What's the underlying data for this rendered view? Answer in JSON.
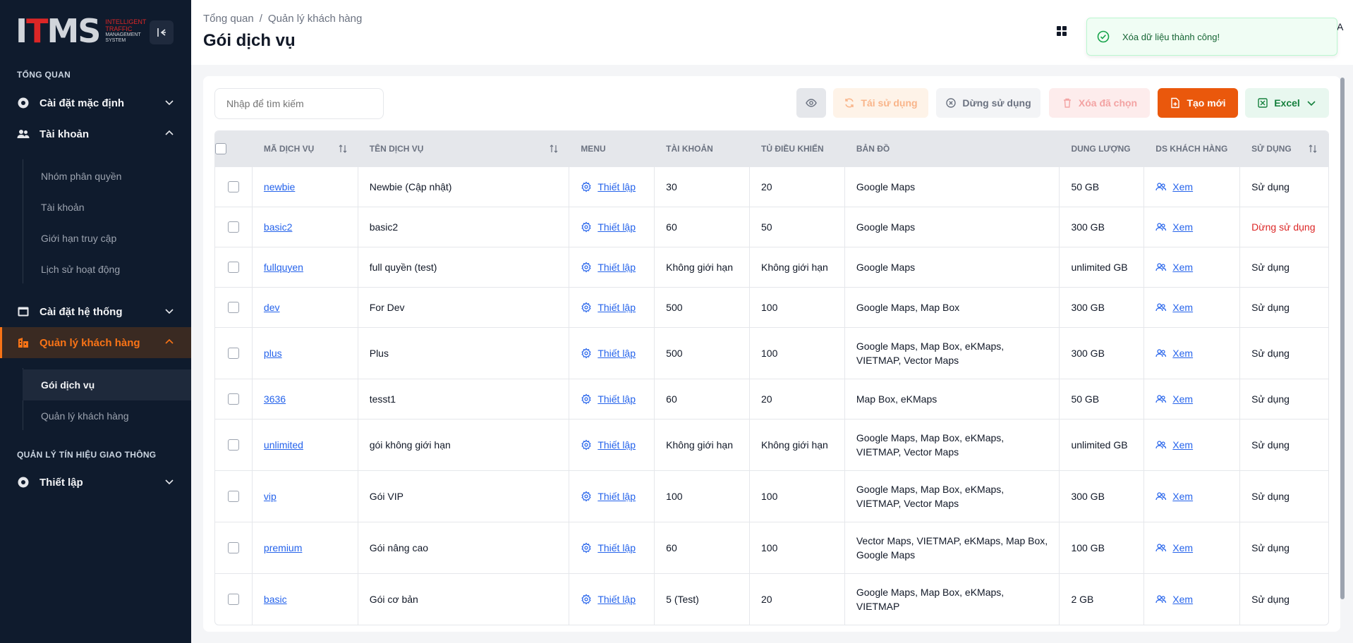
{
  "sidebar": {
    "logo_mark": "ITMS",
    "logo_lines": [
      "INTELLIGENT",
      "TRAFFIC",
      "MANAGEMENT",
      "SYSTEM"
    ],
    "section1": "TỔNG QUAN",
    "section2": "QUẢN LÝ TÍN HIỆU GIAO THÔNG",
    "items": [
      {
        "label": "Cài đặt mặc định",
        "icon": "gear-icon"
      },
      {
        "label": "Tài khoản",
        "icon": "users-icon"
      },
      {
        "label": "Cài đặt hệ thống",
        "icon": "window-icon"
      },
      {
        "label": "Quản lý khách hàng",
        "icon": "building-icon"
      },
      {
        "label": "Thiết lập",
        "icon": "gear-icon"
      }
    ],
    "account_sub": [
      "Nhóm phân quyền",
      "Tài khoản",
      "Giới hạn truy cập",
      "Lịch sử hoạt động"
    ],
    "customer_sub": [
      "Gói dịch vụ",
      "Quản lý khách hàng"
    ]
  },
  "header": {
    "breadcrumb": [
      "Tổng quan",
      "/",
      "Quản lý khách hàng"
    ],
    "title": "Gói dịch vụ",
    "user_initial": "A"
  },
  "toast": {
    "message": "Xóa dữ liệu thành công!"
  },
  "toolbar": {
    "search_placeholder": "Nhập để tìm kiếm",
    "reuse_label": "Tái sử dụng",
    "stop_label": "Dừng sử dụng",
    "delete_label": "Xóa đã chọn",
    "create_label": "Tạo mới",
    "excel_label": "Excel"
  },
  "table": {
    "headers": [
      "MÃ DỊCH VỤ",
      "TÊN DỊCH VỤ",
      "MENU",
      "TÀI KHOẢN",
      "TỦ ĐIỀU KHIỂN",
      "BẢN ĐỒ",
      "DUNG LƯỢNG",
      "DS KHÁCH HÀNG",
      "SỬ DỤNG"
    ],
    "menu_action": "Thiết lập",
    "view_action": "Xem",
    "rows": [
      {
        "code": "newbie",
        "name": "Newbie (Cập nhật)",
        "accounts": "30",
        "controllers": "20",
        "maps": "Google Maps",
        "storage": "50 GB",
        "status": "Sử dụng"
      },
      {
        "code": "basic2",
        "name": "basic2",
        "accounts": "60",
        "controllers": "50",
        "maps": "Google Maps",
        "storage": "300 GB",
        "status": "Dừng sử dụng"
      },
      {
        "code": "fullquyen",
        "name": "full quyền (test)",
        "accounts": "Không giới hạn",
        "controllers": "Không giới hạn",
        "maps": "Google Maps",
        "storage": "unlimited GB",
        "status": "Sử dụng"
      },
      {
        "code": "dev",
        "name": "For Dev",
        "accounts": "500",
        "controllers": "100",
        "maps": "Google Maps, Map Box",
        "storage": "300 GB",
        "status": "Sử dụng"
      },
      {
        "code": "plus",
        "name": "Plus",
        "accounts": "500",
        "controllers": "100",
        "maps": "Google Maps, Map Box, eKMaps, VIETMAP, Vector Maps",
        "storage": "300 GB",
        "status": "Sử dụng"
      },
      {
        "code": "3636",
        "name": "tesst1",
        "accounts": "60",
        "controllers": "20",
        "maps": "Map Box, eKMaps",
        "storage": "50 GB",
        "status": "Sử dụng"
      },
      {
        "code": "unlimited",
        "name": "gói không giới hạn",
        "accounts": "Không giới hạn",
        "controllers": "Không giới hạn",
        "maps": "Google Maps, Map Box, eKMaps, VIETMAP, Vector Maps",
        "storage": "unlimited GB",
        "status": "Sử dụng"
      },
      {
        "code": "vip",
        "name": "Gói VIP",
        "accounts": "100",
        "controllers": "100",
        "maps": "Google Maps, Map Box, eKMaps, VIETMAP, Vector Maps",
        "storage": "300 GB",
        "status": "Sử dụng"
      },
      {
        "code": "premium",
        "name": "Gói nâng cao",
        "accounts": "60",
        "controllers": "100",
        "maps": "Vector Maps, VIETMAP, eKMaps, Map Box, Google Maps",
        "storage": "100 GB",
        "status": "Sử dụng"
      },
      {
        "code": "basic",
        "name": "Gói cơ bản",
        "accounts": "5 (Test)",
        "controllers": "20",
        "maps": "Google Maps, Map Box, eKMaps, VIETMAP",
        "storage": "2 GB",
        "status": "Sử dụng"
      }
    ]
  },
  "colors": {
    "accent": "#ea580c",
    "sidebar_bg": "#0f1b2d",
    "link": "#2563eb",
    "danger": "#dc2626",
    "success": "#15803d"
  }
}
